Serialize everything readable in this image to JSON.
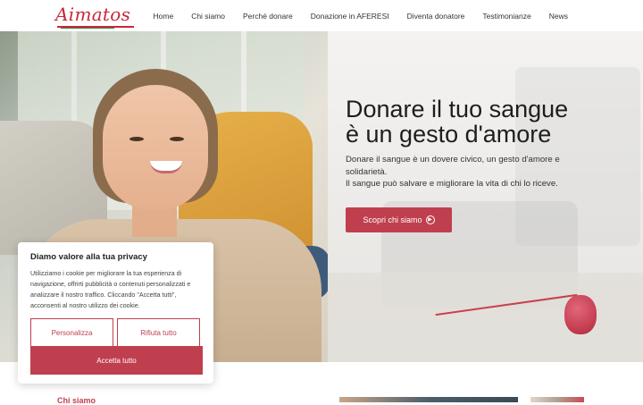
{
  "brand": {
    "logo_text": "Aimatos"
  },
  "nav": [
    {
      "label": "Home"
    },
    {
      "label": "Chi siamo"
    },
    {
      "label": "Perché donare"
    },
    {
      "label": "Donazione in AFERESI"
    },
    {
      "label": "Diventa donatore"
    },
    {
      "label": "Testimonianze"
    },
    {
      "label": "News"
    }
  ],
  "hero": {
    "title_line1": "Donare il tuo sangue",
    "title_line2": "è un gesto d'amore",
    "desc_line1": "Donare il sangue è un dovere civico, un gesto d'amore e solidarietà.",
    "desc_line2": "Il sangue può salvare e migliorare la vita di chi lo riceve.",
    "button_label": "Scopri chi siamo"
  },
  "cookie": {
    "title": "Diamo valore alla tua privacy",
    "text": "Utilizziamo i cookie per migliorare la tua esperienza di navigazione, offrirti pubblicità o contenuti personalizzati e analizzare il nostro traffico. Cliccando \"Accetta tutti\", acconsenti al nostro utilizzo dei cookie.",
    "customize_label": "Personalizza",
    "reject_label": "Rifiuta tutto",
    "accept_label": "Accetta tutto"
  },
  "below": {
    "section_label": "Chi siamo"
  },
  "colors": {
    "brand_red": "#c03f4e",
    "logo_green": "#2f8b3a"
  },
  "icons": {
    "button_icon": "arrow-circle-right-icon"
  }
}
